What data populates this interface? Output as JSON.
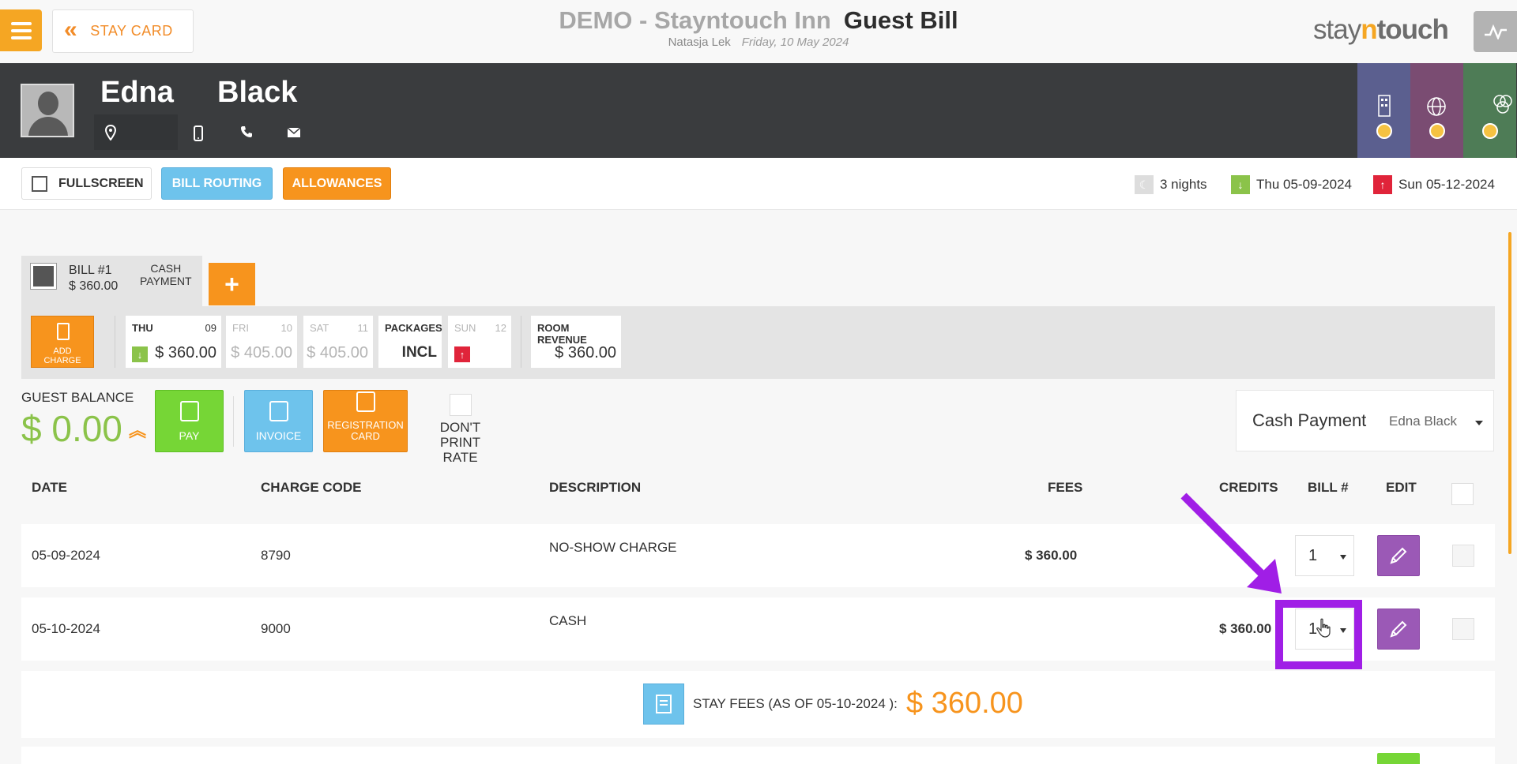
{
  "header": {
    "back_label": "STAY CARD",
    "hotel_name": "DEMO - Stayntouch Inn",
    "page_title": "Guest Bill",
    "user_name": "Natasja Lek",
    "business_date": "Friday, 10 May 2024",
    "brand": {
      "stay": "stay",
      "n": "n",
      "touch": "touch"
    }
  },
  "guest": {
    "first_name": "Edna",
    "last_name": "Black"
  },
  "toolbar": {
    "fullscreen_label": "FULLSCREEN",
    "bill_routing_label": "BILL ROUTING",
    "allowances_label": "ALLOWANCES",
    "nights": "3 nights",
    "arrival": "Thu 05-09-2024",
    "departure": "Sun 05-12-2024"
  },
  "bill_tab": {
    "number": "BILL #1",
    "amount": "$ 360.00",
    "payment_line1": "CASH",
    "payment_line2": "PAYMENT",
    "add_label": "+"
  },
  "charges_bar": {
    "add_charge_line1": "ADD",
    "add_charge_line2": "CHARGE",
    "days": [
      {
        "day": "THU",
        "num": "09",
        "amount": "$ 360.00",
        "marker": "arrival"
      },
      {
        "day": "FRI",
        "num": "10",
        "amount": "$ 405.00",
        "marker": ""
      },
      {
        "day": "SAT",
        "num": "11",
        "amount": "$ 405.00",
        "marker": ""
      },
      {
        "day": "PACKAGES",
        "num": "",
        "amount": "INCL",
        "marker": ""
      },
      {
        "day": "SUN",
        "num": "12",
        "amount": "",
        "marker": "departure"
      }
    ],
    "room_revenue_label": "ROOM REVENUE",
    "room_revenue_amount": "$ 360.00"
  },
  "balance": {
    "label": "GUEST BALANCE",
    "value": "$ 0.00",
    "pay_label": "PAY",
    "invoice_label": "INVOICE",
    "registration_line1": "REGISTRATION",
    "registration_line2": "CARD",
    "dont_print_line1": "DON'T PRINT",
    "dont_print_line2": "RATE"
  },
  "payment": {
    "method": "Cash Payment",
    "payer": "Edna Black"
  },
  "table": {
    "headers": {
      "date": "DATE",
      "charge_code": "CHARGE CODE",
      "description": "DESCRIPTION",
      "fees": "FEES",
      "credits": "CREDITS",
      "bill": "BILL #",
      "edit": "EDIT"
    },
    "rows": [
      {
        "date": "05-09-2024",
        "code": "8790",
        "description": "NO-SHOW CHARGE",
        "fees": "$ 360.00",
        "credits": "",
        "bill": "1"
      },
      {
        "date": "05-10-2024",
        "code": "9000",
        "description": "CASH",
        "fees": "",
        "credits": "$ 360.00",
        "bill": "1"
      }
    ]
  },
  "stay_fees": {
    "label": "STAY FEES (AS OF  05-10-2024 ):",
    "amount": "$ 360.00"
  },
  "colors": {
    "accent_orange": "#f7941d",
    "blue": "#6ec3ec",
    "green": "#76d636",
    "purple": "#9b59b6",
    "annotation": "#a01ee6"
  }
}
